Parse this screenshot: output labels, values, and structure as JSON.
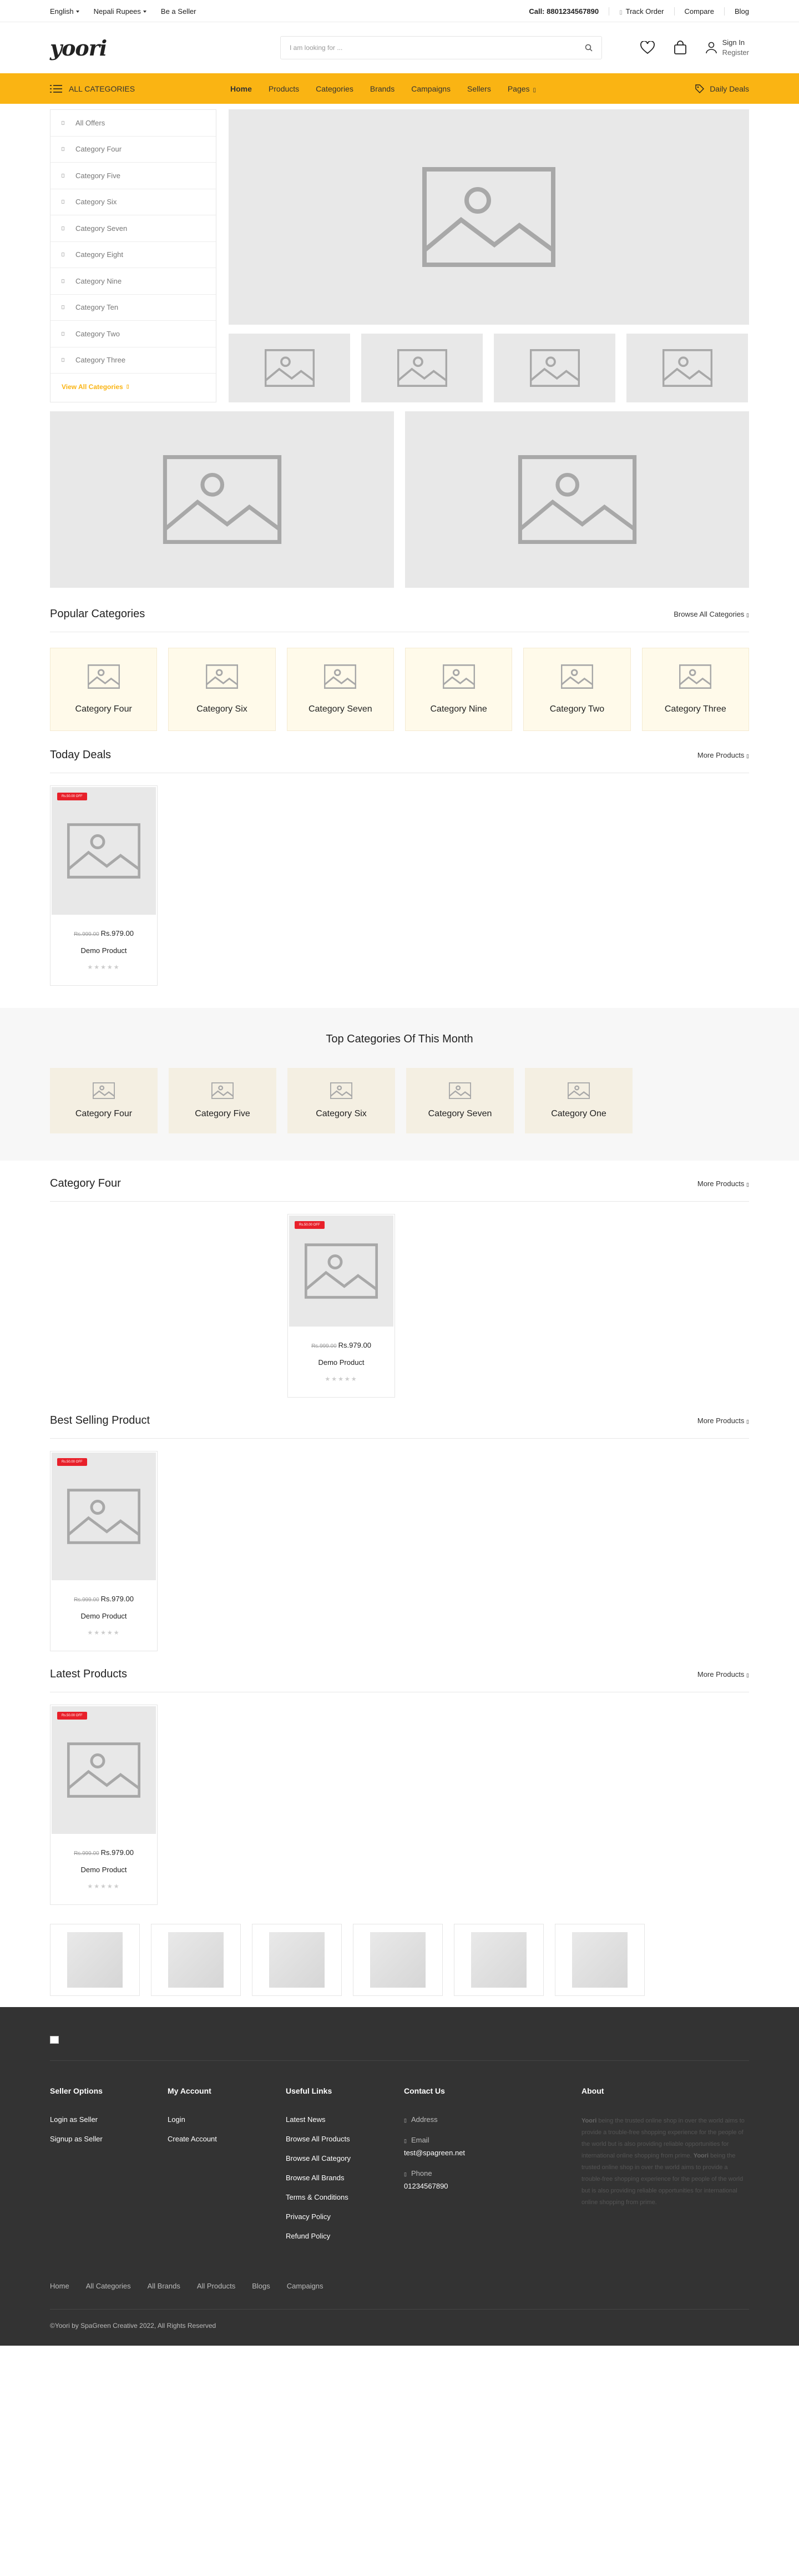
{
  "topbar": {
    "language": "English",
    "currency": "Nepali Rupees",
    "be_seller": "Be a Seller",
    "call": "Call: 8801234567890",
    "track_order": "Track Order",
    "compare": "Compare",
    "blog": "Blog"
  },
  "header": {
    "logo": "yoori",
    "search_placeholder": "I am looking for ...",
    "sign_in": "Sign In",
    "register": "Register"
  },
  "nav": {
    "all_categories": "ALL CATEGORIES",
    "items": [
      "Home",
      "Products",
      "Categories",
      "Brands",
      "Campaigns",
      "Sellers",
      "Pages"
    ],
    "daily_deals": "Daily Deals"
  },
  "sidebar": {
    "items": [
      "All Offers",
      "Category Four",
      "Category Five",
      "Category Six",
      "Category Seven",
      "Category Eight",
      "Category Nine",
      "Category Ten",
      "Category Two",
      "Category Three"
    ],
    "view_all": "View All Categories"
  },
  "popular": {
    "title": "Popular Categories",
    "browse": "Browse All Categories",
    "items": [
      "Category Four",
      "Category Six",
      "Category Seven",
      "Category Nine",
      "Category Two",
      "Category Three"
    ]
  },
  "product": {
    "badge": "Rs.50.00 OFF",
    "old_price": "Rs.999.00",
    "price": "Rs.979.00",
    "name": "Demo Product",
    "stars": "★★★★★"
  },
  "today_deals": {
    "title": "Today Deals",
    "more": "More Products"
  },
  "top_categories": {
    "title": "Top Categories Of This Month",
    "items": [
      "Category Four",
      "Category Five",
      "Category Six",
      "Category Seven",
      "Category One"
    ]
  },
  "category_four": {
    "title": "Category Four",
    "more": "More Products"
  },
  "best_selling": {
    "title": "Best Selling Product",
    "more": "More Products"
  },
  "latest": {
    "title": "Latest Products",
    "more": "More Products"
  },
  "footer": {
    "seller_options": {
      "title": "Seller Options",
      "links": [
        "Login as Seller",
        "Signup as Seller"
      ]
    },
    "my_account": {
      "title": "My Account",
      "links": [
        "Login",
        "Create Account"
      ]
    },
    "useful_links": {
      "title": "Useful Links",
      "links": [
        "Latest News",
        "Browse All Products",
        "Browse All Category",
        "Browse All Brands",
        "Terms & Conditions",
        "Privacy Policy",
        "Refund Policy"
      ]
    },
    "contact": {
      "title": "Contact Us",
      "address_label": "Address",
      "email_label": "Email",
      "email": "test@spagreen.net",
      "phone_label": "Phone",
      "phone": "01234567890"
    },
    "about": {
      "title": "About",
      "brand": "Yoori",
      "text1": "being the trusted online shop in over the world aims to provide a trouble-free shopping experience for the people of the world but is also providing reliable opportunities for international online shopping from prime.",
      "text2": "being the trusted online shop in over the world aims to provide a trouble-free shopping experience for the people of the world but is also providing reliable opportunities for international online shopping from prime."
    },
    "bottom_links": [
      "Home",
      "All Categories",
      "All Brands",
      "All Products",
      "Blogs",
      "Campaigns"
    ],
    "copyright": "©Yoori by SpaGreen Creative 2022, All Rights Reserved"
  },
  "colors": {
    "accent": "#fab413",
    "badge": "#e8202a",
    "footer_bg": "#333333"
  }
}
